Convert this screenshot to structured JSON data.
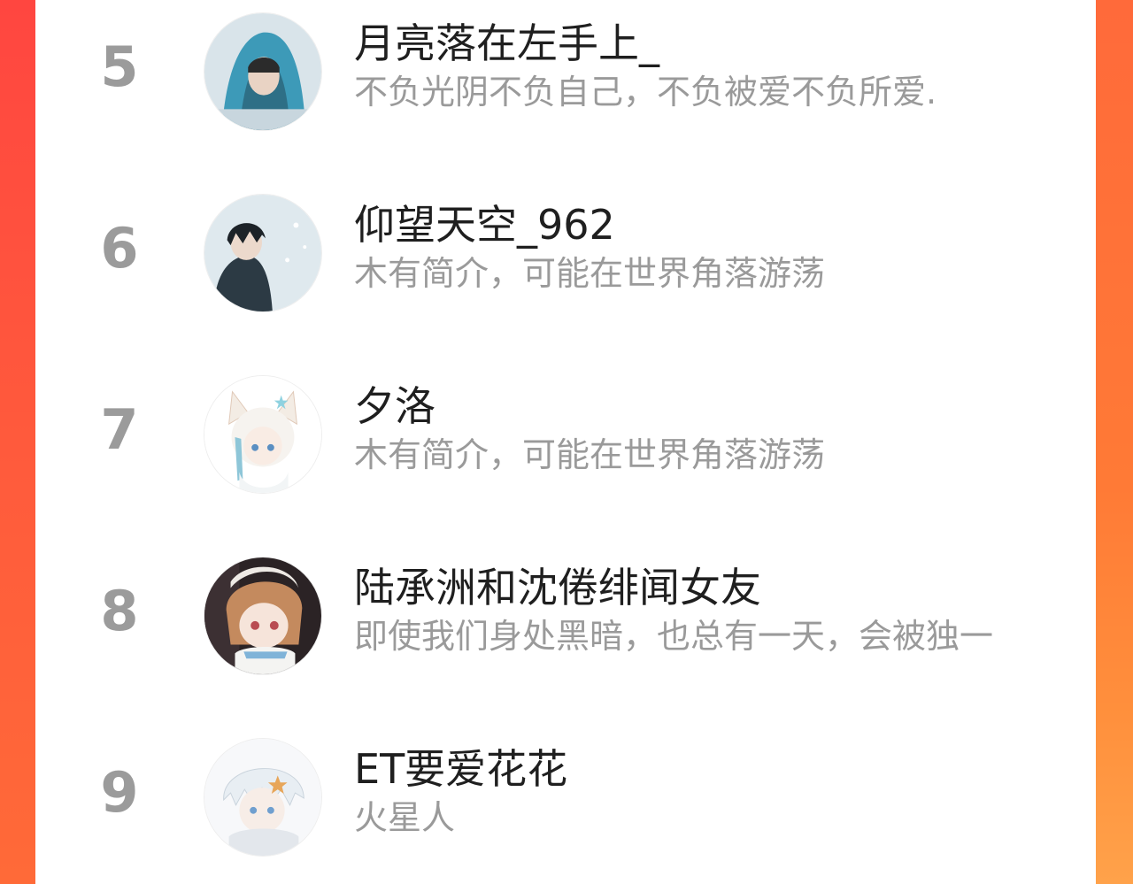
{
  "ranking": {
    "rows": [
      {
        "rank": "5",
        "name": "月亮落在左手上_",
        "bio": "不负光阴不负自己，不负被爱不负所爱.",
        "avatar_icon": "avatar-hooded-boy-icon"
      },
      {
        "rank": "6",
        "name": "仰望天空_962",
        "bio": "木有简介，可能在世界角落游荡",
        "avatar_icon": "avatar-anime-boy-snow-icon"
      },
      {
        "rank": "7",
        "name": "夕洛",
        "bio": "木有简介，可能在世界角落游荡",
        "avatar_icon": "avatar-cat-ear-girl-icon"
      },
      {
        "rank": "8",
        "name": "陆承洲和沈倦绯闻女友",
        "bio": "即使我们身处黑暗，也总有一天，会被独一",
        "avatar_icon": "avatar-brown-hair-girl-icon"
      },
      {
        "rank": "9",
        "name": "ET要爱花花",
        "bio": "火星人",
        "avatar_icon": "avatar-white-hair-boy-icon"
      }
    ]
  },
  "colors": {
    "accent_gradient_top": "#ff4a3d",
    "accent_gradient_bottom": "#ff9a3d",
    "rank_gray": "#9b9b9b",
    "name_text": "#1f1f1f",
    "bio_text": "#9a9a9a"
  }
}
